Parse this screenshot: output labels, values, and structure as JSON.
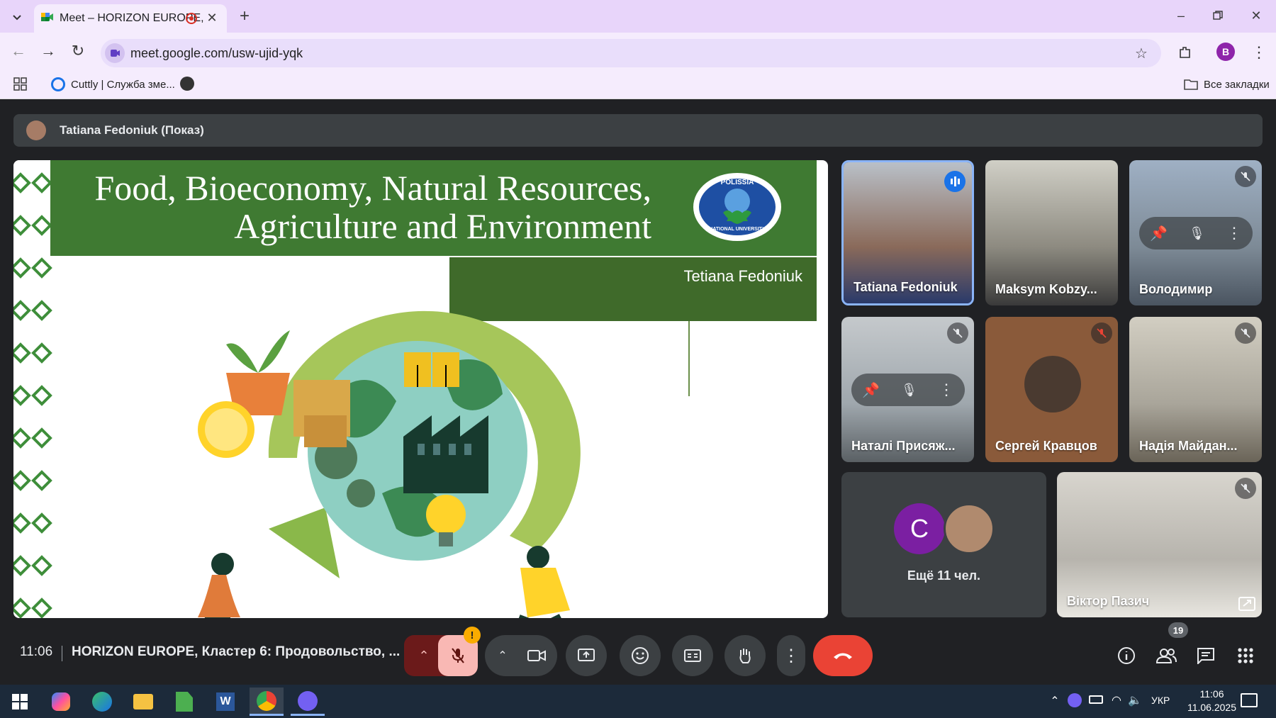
{
  "browser": {
    "tab_title": "Meet – HORIZON EUROPE,",
    "url": "meet.google.com/usw-ujid-yqk",
    "profile_initial": "B",
    "bookmark_1": "Cuttly | Служба зме...",
    "all_bookmarks": "Все закладки"
  },
  "meet": {
    "presenter_label": "Tatiana Fedoniuk (Показ)",
    "slide": {
      "title_line1": "Food, Bioeconomy, Natural Resources,",
      "title_line2": "Agriculture and  Environment",
      "author": "Tetiana Fedoniuk",
      "logo_top": "POLISSIA",
      "logo_bottom": "NATIONAL UNIVERSITY"
    },
    "participants": [
      {
        "name": "Tatiana Fedoniuk",
        "color": "#8a6a5a"
      },
      {
        "name": "Maksym Kobzy...",
        "color": "#8d8a80"
      },
      {
        "name": "Володимир",
        "color": "#7d8a96"
      },
      {
        "name": "Наталі Присяж...",
        "color": "#9fa7ad"
      },
      {
        "name": "Сергей Кравцов",
        "color": "#8a5a3a"
      },
      {
        "name": "Надія Майдан...",
        "color": "#a9a59a"
      },
      {
        "name": "Віктор Пазич",
        "color": "#b7b4ad"
      }
    ],
    "more_tile": {
      "initial": "C",
      "label": "Ещё 11 чел."
    },
    "time": "11:06",
    "meeting_title": "HORIZON EUROPE, Кластер 6: Продовольство, ...",
    "participant_count": "19",
    "mic_warning": "!",
    "accent_red": "#ea4335",
    "accent_blue": "#8ab4f8"
  },
  "taskbar": {
    "lang": "УКР",
    "clock_time": "11:06",
    "clock_date": "11.06.2025"
  }
}
